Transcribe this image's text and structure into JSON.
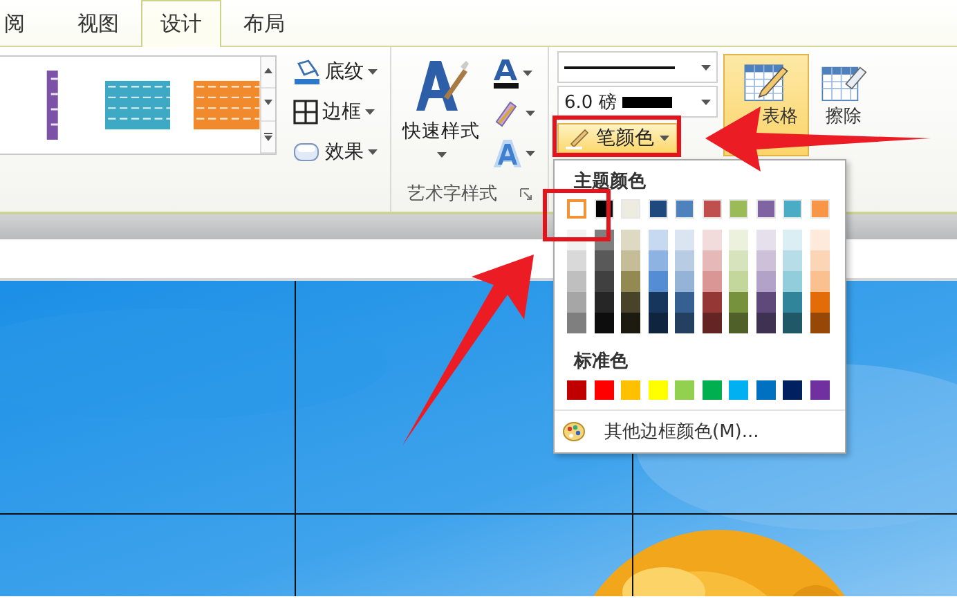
{
  "tabs": [
    {
      "label": "阅",
      "selected": false
    },
    {
      "label": "视图",
      "selected": false
    },
    {
      "label": "设计",
      "selected": true
    },
    {
      "label": "布局",
      "selected": false
    }
  ],
  "table_styles": [
    {
      "color": "#7b52a6"
    },
    {
      "color": "#3ea9c4"
    },
    {
      "color": "#f08a2c"
    }
  ],
  "border_buttons": [
    {
      "label": "底纹",
      "kind": "shading"
    },
    {
      "label": "边框",
      "kind": "borders"
    },
    {
      "label": "效果",
      "kind": "effects"
    }
  ],
  "wordart": {
    "quick_styles": "快速样式",
    "group_label": "艺术字样式"
  },
  "pen": {
    "weight": "6.0 磅",
    "color_button": {
      "label": "笔颜色",
      "open": true
    }
  },
  "draw_table": {
    "label": "表格",
    "selected": true
  },
  "erase": {
    "label": "擦除"
  },
  "color_menu": {
    "theme_header": "主题颜色",
    "theme_colors": [
      {
        "color": "#ffffff",
        "selected": true,
        "shades": [
          {
            "color": "#f2f2f2"
          },
          {
            "color": "#d9d9d9"
          },
          {
            "color": "#bfbfbf"
          },
          {
            "color": "#a6a6a6"
          },
          {
            "color": "#7f7f7f"
          }
        ]
      },
      {
        "color": "#000000",
        "selected": false,
        "shades": [
          {
            "color": "#7f7f7f"
          },
          {
            "color": "#595959"
          },
          {
            "color": "#404040"
          },
          {
            "color": "#262626"
          },
          {
            "color": "#0d0d0d"
          }
        ]
      },
      {
        "color": "#eeece1",
        "selected": false,
        "shades": [
          {
            "color": "#ddd9c3"
          },
          {
            "color": "#c4bd97"
          },
          {
            "color": "#938953"
          },
          {
            "color": "#494429"
          },
          {
            "color": "#1d1b10"
          }
        ]
      },
      {
        "color": "#1f497d",
        "selected": false,
        "shades": [
          {
            "color": "#c6d9f0"
          },
          {
            "color": "#8db3e2"
          },
          {
            "color": "#548dd4"
          },
          {
            "color": "#17365d"
          },
          {
            "color": "#0f243e"
          }
        ]
      },
      {
        "color": "#4f81bd",
        "selected": false,
        "shades": [
          {
            "color": "#dbe5f1"
          },
          {
            "color": "#b8cce4"
          },
          {
            "color": "#95b3d7"
          },
          {
            "color": "#366092"
          },
          {
            "color": "#244061"
          }
        ]
      },
      {
        "color": "#c0504d",
        "selected": false,
        "shades": [
          {
            "color": "#f2dcdb"
          },
          {
            "color": "#e5b9b7"
          },
          {
            "color": "#d99694"
          },
          {
            "color": "#953734"
          },
          {
            "color": "#632423"
          }
        ]
      },
      {
        "color": "#9bbb59",
        "selected": false,
        "shades": [
          {
            "color": "#ebf1dd"
          },
          {
            "color": "#d7e3bc"
          },
          {
            "color": "#c3d69b"
          },
          {
            "color": "#76923c"
          },
          {
            "color": "#4f6128"
          }
        ]
      },
      {
        "color": "#8064a2",
        "selected": false,
        "shades": [
          {
            "color": "#e5e0ec"
          },
          {
            "color": "#ccc1d9"
          },
          {
            "color": "#b2a2c7"
          },
          {
            "color": "#5f497a"
          },
          {
            "color": "#3f3151"
          }
        ]
      },
      {
        "color": "#4bacc6",
        "selected": false,
        "shades": [
          {
            "color": "#dbeef3"
          },
          {
            "color": "#b7dde8"
          },
          {
            "color": "#92cddc"
          },
          {
            "color": "#31859b"
          },
          {
            "color": "#205867"
          }
        ]
      },
      {
        "color": "#f79646",
        "selected": false,
        "shades": [
          {
            "color": "#fdeada"
          },
          {
            "color": "#fbd5b5"
          },
          {
            "color": "#fac08f"
          },
          {
            "color": "#e36c09"
          },
          {
            "color": "#974806"
          }
        ]
      }
    ],
    "standard_header": "标准色",
    "standard_colors": [
      {
        "color": "#c00000"
      },
      {
        "color": "#ff0000"
      },
      {
        "color": "#ffc000"
      },
      {
        "color": "#ffff00"
      },
      {
        "color": "#92d050"
      },
      {
        "color": "#00b050"
      },
      {
        "color": "#00b0f0"
      },
      {
        "color": "#0070c0"
      },
      {
        "color": "#002060"
      },
      {
        "color": "#7030a0"
      }
    ],
    "more_colors": "其他边框颜色(M)..."
  },
  "annotations": [
    {
      "kind": "box"
    },
    {
      "kind": "box"
    },
    {
      "kind": "arrow"
    },
    {
      "kind": "arrow"
    }
  ]
}
